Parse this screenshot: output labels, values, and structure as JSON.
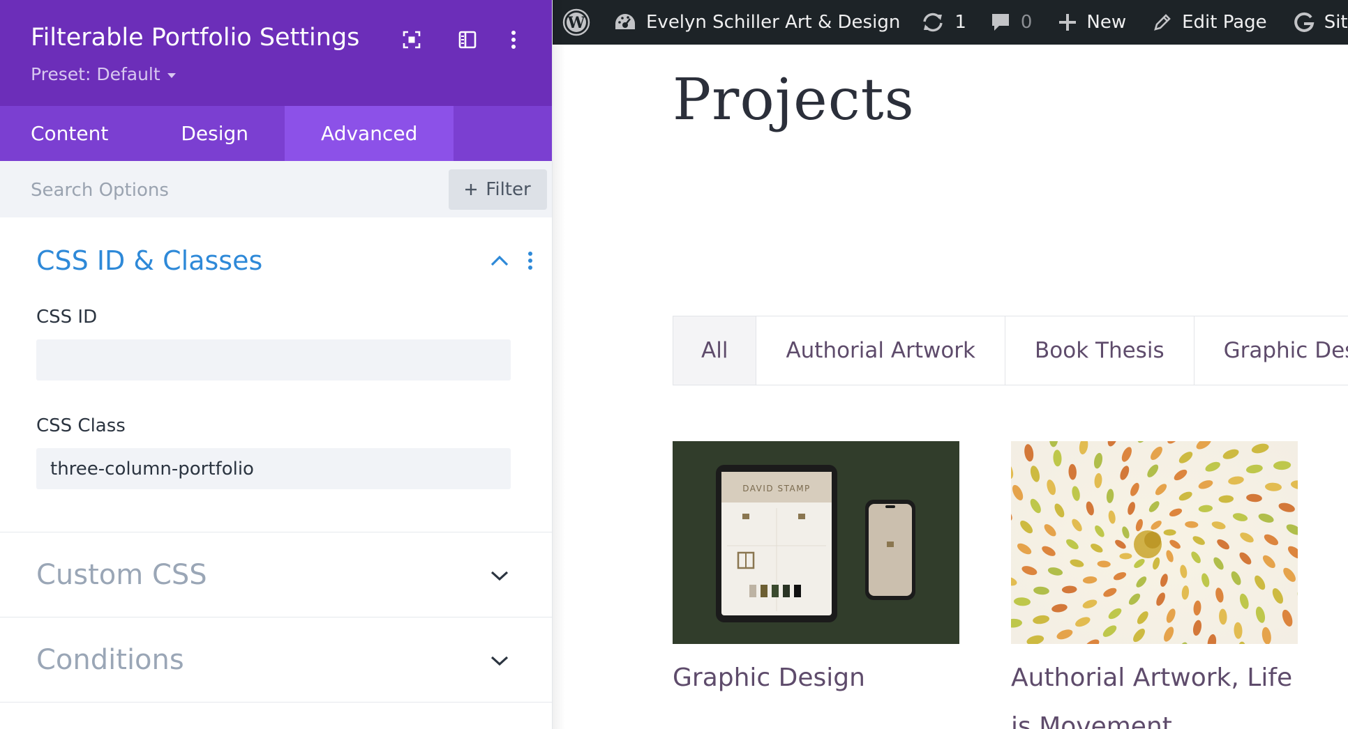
{
  "panel": {
    "title": "Filterable Portfolio Settings",
    "preset_label": "Preset: Default",
    "tabs": [
      {
        "label": "Content"
      },
      {
        "label": "Design"
      },
      {
        "label": "Advanced"
      }
    ],
    "active_tab": "Advanced",
    "search": {
      "placeholder": "Search Options",
      "value": ""
    },
    "filter_label": "Filter",
    "sections": {
      "css_id_classes": {
        "title": "CSS ID & Classes",
        "css_id_label": "CSS ID",
        "css_id_value": "",
        "css_class_label": "CSS Class",
        "css_class_value": "three-column-portfolio"
      },
      "custom_css": {
        "title": "Custom CSS"
      },
      "conditions": {
        "title": "Conditions"
      }
    },
    "colors": {
      "header": "#6c2eb9",
      "tabs": "#7b3fd1",
      "tab_active": "#8c51e8",
      "section_title": "#2e89d8"
    }
  },
  "adminbar": {
    "site_name": "Evelyn Schiller Art & Design",
    "updates_count": "1",
    "comments_count": "0",
    "new_label": "New",
    "edit_label": "Edit Page",
    "site_kit_label": "Site K"
  },
  "page": {
    "title": "Projects",
    "filters": [
      {
        "label": "All",
        "active": true
      },
      {
        "label": "Authorial Artwork"
      },
      {
        "label": "Book Thesis"
      },
      {
        "label": "Graphic Des"
      }
    ],
    "items": [
      {
        "caption": "Graphic Design",
        "thumb_text": "DAVID STAMP"
      },
      {
        "caption": "Authorial Artwork, Life is Movement"
      }
    ]
  }
}
